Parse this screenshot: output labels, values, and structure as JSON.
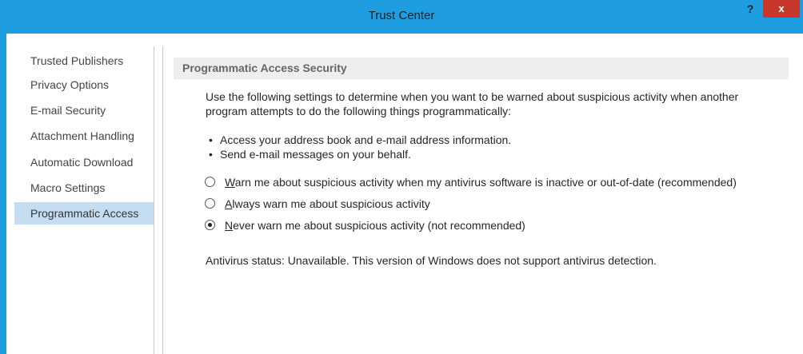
{
  "window": {
    "title": "Trust Center",
    "help_label": "?",
    "close_label": "x"
  },
  "sidebar": {
    "items": [
      {
        "label": "Trusted Publishers"
      },
      {
        "label": "Privacy Options"
      },
      {
        "label": "E-mail Security"
      },
      {
        "label": "Attachment Handling"
      },
      {
        "label": "Automatic Download"
      },
      {
        "label": "Macro Settings"
      },
      {
        "label": "Programmatic Access",
        "selected": true
      }
    ]
  },
  "content": {
    "section_title": "Programmatic Access Security",
    "description_line1": "Use the following settings to determine when you want to be warned about suspicious activity when another",
    "description_line2": "program attempts to do the following things programmatically:",
    "bullets": [
      "Access your address book and e-mail address information.",
      "Send e-mail messages on your behalf."
    ],
    "options": [
      {
        "access_key": "W",
        "rest": "arn me about suspicious activity when my antivirus software is inactive or out-of-date (recommended)",
        "selected": false
      },
      {
        "access_key": "A",
        "rest": "lways warn me about suspicious activity",
        "selected": false
      },
      {
        "access_key": "N",
        "rest": "ever warn me about suspicious activity (not recommended)",
        "selected": true
      }
    ],
    "antivirus_status": "Antivirus status: Unavailable. This version of Windows does not support antivirus detection."
  },
  "colors": {
    "title_bar": "#1e9de0",
    "close_button": "#c8372c",
    "selected_item": "#c5ddf1"
  }
}
